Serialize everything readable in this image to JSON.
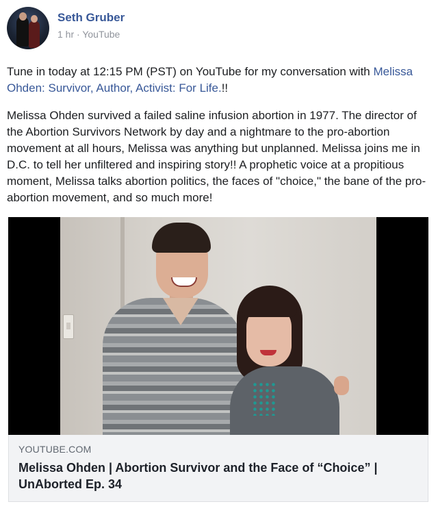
{
  "post": {
    "author": "Seth Gruber",
    "meta": "1 hr · YouTube",
    "text_line1_prefix": "Tune in today at 12:15 PM (PST) on YouTube for my conversation with",
    "text_link": "Melissa Ohden: Survivor, Author, Activist: For Life.",
    "text_link_suffix": "!!",
    "paragraph2": "Melissa Ohden survived a failed saline infusion abortion in 1977. The director of the Abortion Survivors Network by day and a nightmare to the pro-abortion movement at all hours, Melissa was anything but unplanned. Melissa joins me in D.C. to tell her unfiltered and inspiring story!! A prophetic voice at a propitious moment, Melissa talks abortion politics, the faces of \"choice,\" the bane of the pro-abortion movement, and so much more!"
  },
  "link_preview": {
    "source": "YOUTUBE.COM",
    "title": "Melissa Ohden | Abortion Survivor and the Face of “Choice” | UnAborted Ep. 34"
  },
  "colors": {
    "link": "#385898",
    "text": "#1c1e21",
    "meta": "#90949c",
    "preview_bg": "#f2f3f5"
  }
}
